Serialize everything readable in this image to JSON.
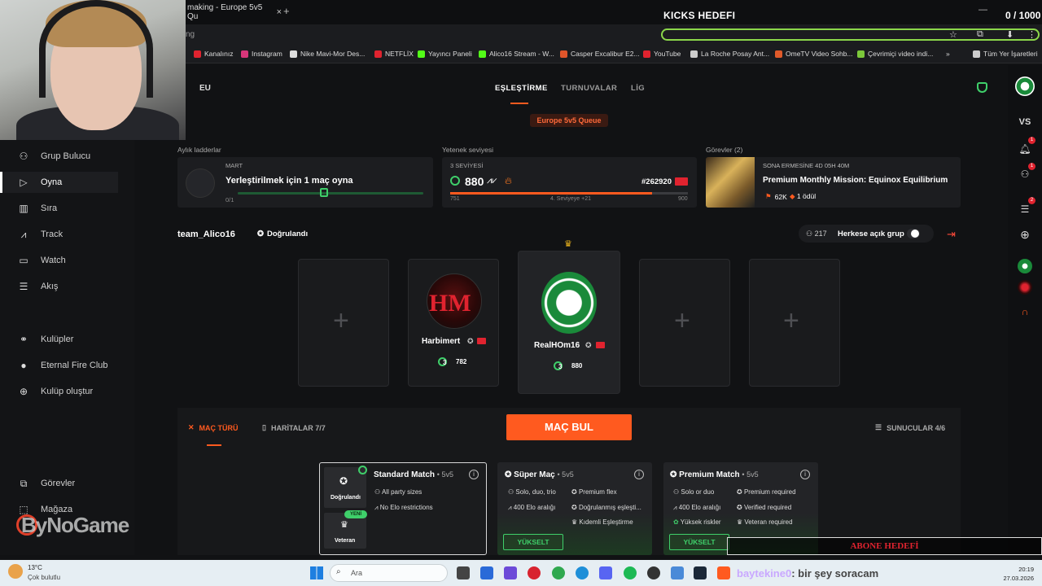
{
  "browser": {
    "tab_title": "making - Europe 5v5 Qu",
    "tab_close": "×",
    "new_tab": "+",
    "url_fragment": "ng",
    "kicks_goal": "KICKS HEDEFI",
    "kicks_count": "0 / 1000",
    "bookmarks": [
      {
        "label": "Kanalınız",
        "color": "#e0232f"
      },
      {
        "label": "Instagram",
        "color": "#d8367a"
      },
      {
        "label": "Nike Mavi-Mor Des...",
        "color": "#dddddd"
      },
      {
        "label": "NETFLİX",
        "color": "#e0232f"
      },
      {
        "label": "Yayıncı Paneli",
        "color": "#53fc18"
      },
      {
        "label": "Alico16 Stream - W...",
        "color": "#53fc18"
      },
      {
        "label": "Casper Excalibur E2...",
        "color": "#e0552a"
      },
      {
        "label": "YouTube",
        "color": "#e0232f"
      },
      {
        "label": "La Roche Posay Ant...",
        "color": "#cccccc"
      },
      {
        "label": "OmeTV Video Sohb...",
        "color": "#e05a2a"
      },
      {
        "label": "Çevrimiçi video indi...",
        "color": "#7cc83a"
      },
      {
        "label": "»",
        "color": ""
      },
      {
        "label": "Tüm Yer İşaretleri",
        "color": "#cccccc"
      }
    ]
  },
  "sidebar": {
    "items": [
      {
        "label": "Grup Bulucu",
        "icon": "users-search-icon"
      },
      {
        "label": "Oyna",
        "icon": "play-icon"
      },
      {
        "label": "Sıra",
        "icon": "podium-icon"
      },
      {
        "label": "Track",
        "icon": "chart-icon"
      },
      {
        "label": "Watch",
        "icon": "watch-icon"
      },
      {
        "label": "Akış",
        "icon": "feed-icon"
      },
      {
        "label": "Kulüpler",
        "icon": "clubs-icon"
      },
      {
        "label": "Eternal Fire Club",
        "icon": "club-avatar-icon"
      },
      {
        "label": "Kulüp oluştur",
        "icon": "plus-circle-icon"
      },
      {
        "label": "Görevler",
        "icon": "missions-icon"
      },
      {
        "label": "Mağaza",
        "icon": "store-icon"
      }
    ],
    "watermark": "ByNoGame"
  },
  "header": {
    "region": "EU",
    "tabs": [
      "EŞLEŞTİRME",
      "TURNUVALAR",
      "LİG"
    ],
    "queue": "Europe 5v5 Queue"
  },
  "rail": {
    "vs": "VS",
    "notif_count": "1",
    "friends_count": "1",
    "party_count": "2"
  },
  "ladder": {
    "section": "Aylık ladderlar",
    "month": "MART",
    "title": "Yerleştirilmek için 1 maç oyna",
    "progress": "0/1",
    "progress_fraction": 0
  },
  "skill": {
    "section": "Yetenek seviyesi",
    "level_text": "3 SEVİYESİ",
    "level": "3",
    "elo": "880",
    "rank": "#262920",
    "min": "751",
    "next": "4. Seviyeye +21",
    "max": "900",
    "progress_fraction": 0.85
  },
  "missions": {
    "section": "Görevler (2)",
    "expires": "SONA ERMESİNE 4D 05H 40M",
    "title": "Premium Monthly Mission: Equinox Equilibrium",
    "xp": "62K",
    "reward": "1 ödül"
  },
  "team": {
    "name": "team_Alico16",
    "verified": "Doğrulandı",
    "group_size": "217",
    "open_group": "Herkese açık grup",
    "players": [
      {
        "name": "Harbimert",
        "level": "3",
        "elo": "782"
      },
      {
        "name": "RealHOm16",
        "level": "3",
        "elo": "880"
      }
    ],
    "empty_slot": "+"
  },
  "match": {
    "tab_type": "MAÇ TÜRÜ",
    "tab_maps": "HARİTALAR 7/7",
    "find": "MAÇ BUL",
    "servers": "SUNUCULAR 4/6",
    "cards": [
      {
        "title": "Standard Match",
        "mode": "• 5v5",
        "features": [
          "All party sizes",
          "No Elo restrictions"
        ],
        "tiers": [
          "Doğrulandı",
          "Veteran"
        ],
        "new": "YENİ"
      },
      {
        "title": "Süper Maç",
        "mode": "• 5v5",
        "features": [
          "Solo, duo, trio",
          "400 Elo aralığı",
          "Premium flex",
          "Doğrulanmış eşleşti...",
          "Kıdemli Eşleştirme"
        ],
        "upgrade": "YÜKSELT"
      },
      {
        "title": "Premium Match",
        "mode": "• 5v5",
        "features": [
          "Solo or duo",
          "400 Elo aralığı",
          "Yüksek riskler",
          "Premium required",
          "Verified required",
          "Veteran required"
        ],
        "upgrade": "YÜKSELT"
      }
    ]
  },
  "overlay": {
    "sub_goal": "ABONE HEDEFİ",
    "chat_user": "baytekine0",
    "chat_text": ": bir şey soracam"
  },
  "taskbar": {
    "temp": "13°C",
    "weather": "Çok bulutlu",
    "search": "Ara",
    "time": "20:19",
    "date": "27.03.2026"
  }
}
